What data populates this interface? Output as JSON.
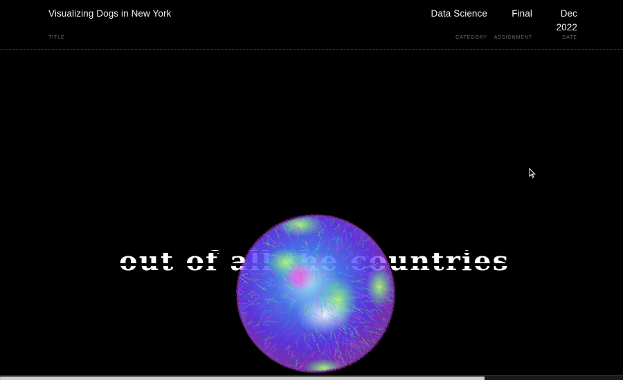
{
  "header": {
    "title": {
      "value": "Visualizing Dogs in New York",
      "label": "TITLE"
    },
    "category": {
      "value": "Data Science",
      "label": "CATEGORY"
    },
    "assignment": {
      "value": "Final",
      "label": "ASSIGNMENT"
    },
    "date": {
      "value": "Dec 2022",
      "label": "DATE"
    }
  },
  "visual": {
    "overlay_text": "out of all the countries",
    "globe_colors": [
      "#b04dff",
      "#5b8cff",
      "#45e0d0",
      "#8aff5a",
      "#ff4fd8"
    ]
  },
  "colors": {
    "background": "#000000",
    "text": "#f2f2f2",
    "label": "#6f6f6f"
  }
}
